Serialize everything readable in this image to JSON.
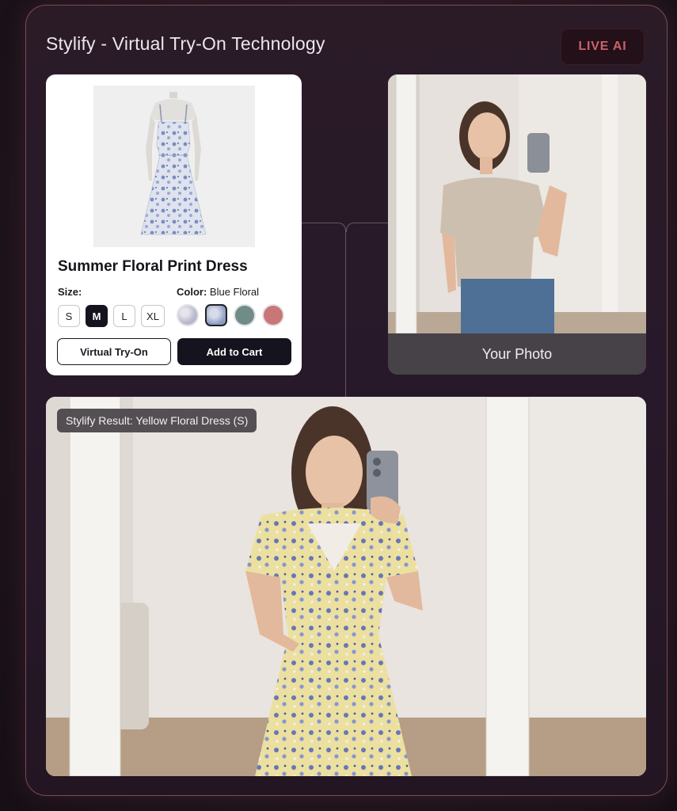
{
  "header": {
    "title": "Stylify - Virtual Try-On Technology",
    "badge": "LIVE AI"
  },
  "product": {
    "name": "Summer Floral Print Dress",
    "size_label": "Size:",
    "sizes": [
      "S",
      "M",
      "L",
      "XL"
    ],
    "selected_size": "M",
    "color_label": "Color:",
    "color_value": "Blue Floral",
    "swatches": [
      {
        "name": "lavender-floral",
        "color": "#c9c8d6"
      },
      {
        "name": "blue-floral",
        "color": "#a9b3cc",
        "selected": true
      },
      {
        "name": "sage-green",
        "color": "#6f8d86"
      },
      {
        "name": "dusty-rose",
        "color": "#c97677"
      }
    ],
    "try_on_label": "Virtual Try-On",
    "cart_label": "Add to Cart"
  },
  "user_photo": {
    "caption": "Your Photo"
  },
  "result": {
    "tag": "Stylify Result: Yellow Floral Dress (S)"
  },
  "colors": {
    "accent": "#c9636e",
    "frame_border": "#7a4a55",
    "button_dark": "#15131d",
    "background": "#24171f"
  }
}
